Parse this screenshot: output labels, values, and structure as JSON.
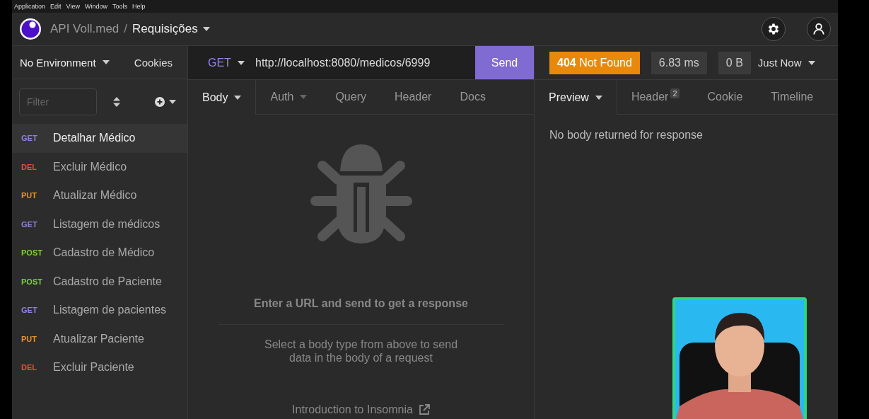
{
  "menu_bar": [
    "Application",
    "Edit",
    "View",
    "Window",
    "Tools",
    "Help"
  ],
  "header": {
    "project": "API Voll.med",
    "separator": "/",
    "collection": "Requisições"
  },
  "sidebar": {
    "environment": "No Environment",
    "cookies": "Cookies",
    "filter": {
      "placeholder": "Filter"
    },
    "requests": [
      {
        "method": "GET",
        "color": "#8f82dd",
        "name": "Detalhar Médico",
        "selected": true
      },
      {
        "method": "DEL",
        "color": "#e0523c",
        "name": "Excluir Médico",
        "selected": false
      },
      {
        "method": "PUT",
        "color": "#e8961a",
        "name": "Atualizar Médico",
        "selected": false
      },
      {
        "method": "GET",
        "color": "#8f82dd",
        "name": "Listagem de médicos",
        "selected": false
      },
      {
        "method": "POST",
        "color": "#7ad13c",
        "name": "Cadastro de Médico",
        "selected": false
      },
      {
        "method": "POST",
        "color": "#7ad13c",
        "name": "Cadastro de Paciente",
        "selected": false
      },
      {
        "method": "GET",
        "color": "#8f82dd",
        "name": "Listagem de pacientes",
        "selected": false
      },
      {
        "method": "PUT",
        "color": "#e8961a",
        "name": "Atualizar Paciente",
        "selected": false
      },
      {
        "method": "DEL",
        "color": "#e0523c",
        "name": "Excluir Paciente",
        "selected": false
      }
    ]
  },
  "request": {
    "method": "GET",
    "url": "http://localhost:8080/medicos/6999",
    "send": "Send",
    "tabs": [
      {
        "label": "Body",
        "selected": true,
        "dropdown": true
      },
      {
        "label": "Auth",
        "selected": false,
        "dropdown": true
      },
      {
        "label": "Query",
        "selected": false,
        "dropdown": false
      },
      {
        "label": "Header",
        "selected": false,
        "dropdown": false
      },
      {
        "label": "Docs",
        "selected": false,
        "dropdown": false
      }
    ],
    "empty": {
      "title": "Enter a URL and send to get a response",
      "hint": "Select a body type from above to send\ndata in the body of a request",
      "link": "Introduction to Insomnia"
    }
  },
  "response": {
    "status": "**404** Not Found",
    "time": "6.83 ms",
    "size": "0 B",
    "when": "Just Now",
    "tabs": [
      {
        "label": "Preview",
        "selected": true,
        "dropdown": true
      },
      {
        "label": "Header",
        "selected": false,
        "dropdown": false,
        "badge": "2"
      },
      {
        "label": "Cookie",
        "selected": false,
        "dropdown": false
      },
      {
        "label": "Timeline",
        "selected": false,
        "dropdown": false
      }
    ],
    "message": "No body returned for response"
  }
}
